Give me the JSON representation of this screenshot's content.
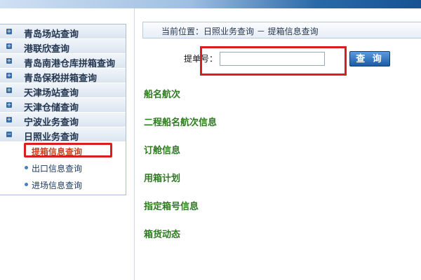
{
  "sidebar": {
    "items": [
      {
        "label": "青岛场站查询"
      },
      {
        "label": "港联欣查询"
      },
      {
        "label": "青岛南港仓库拼箱查询"
      },
      {
        "label": "青岛保税拼箱查询"
      },
      {
        "label": "天津场站查询"
      },
      {
        "label": "天津仓储查询"
      },
      {
        "label": "宁波业务查询"
      },
      {
        "label": "日照业务查询"
      }
    ],
    "subitems": [
      {
        "label": "提箱信息查询",
        "active": true
      },
      {
        "label": "出口信息查询",
        "active": false
      },
      {
        "label": "进场信息查询",
        "active": false
      }
    ]
  },
  "breadcrumb": "当前位置：日照业务查询 － 提箱信息查询",
  "form": {
    "label": "提单号：",
    "value": "",
    "button": "查 询"
  },
  "sections": [
    {
      "label": "船名航次"
    },
    {
      "label": "二程船名航次信息"
    },
    {
      "label": "订舱信息"
    },
    {
      "label": "用箱计划"
    },
    {
      "label": "指定箱号信息"
    },
    {
      "label": "箱货动态"
    }
  ],
  "colors": {
    "highlight": "#d81e1e",
    "section_text": "#2d7a1f",
    "active_sub": "#c8431c"
  }
}
